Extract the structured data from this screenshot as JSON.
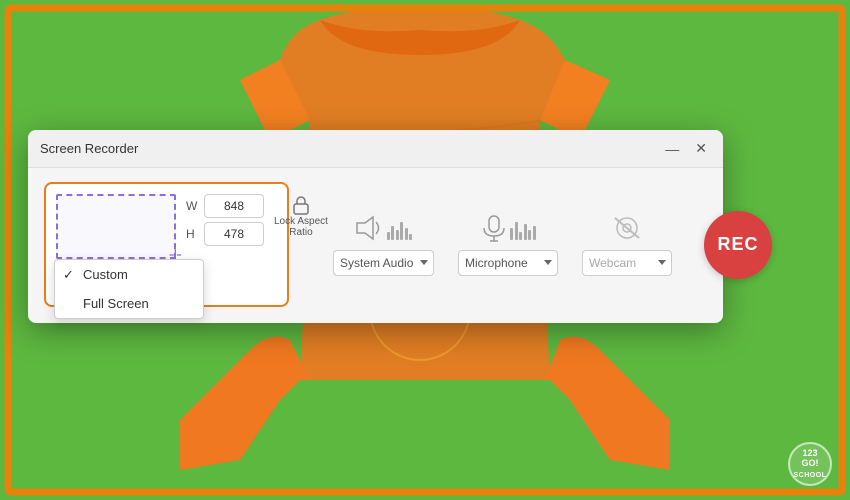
{
  "background": {
    "color": "#5aaa3c"
  },
  "dialog": {
    "title": "Screen Recorder",
    "minimize_label": "—",
    "close_label": "✕"
  },
  "region": {
    "width_label": "W",
    "height_label": "H",
    "width_value": "848",
    "height_value": "478",
    "dropdown_selected": "Custom",
    "lock_label1": "Lock Aspect",
    "lock_label2": "Ratio"
  },
  "dropdown_menu": {
    "items": [
      {
        "label": "Custom",
        "selected": true
      },
      {
        "label": "Full Screen",
        "selected": false
      }
    ]
  },
  "audio": {
    "system_label": "System Audio",
    "mic_label": "Microphone",
    "webcam_label": "Webcam"
  },
  "rec_button": {
    "label": "REC"
  },
  "logo": {
    "line1": "123",
    "line2": "GO!",
    "line3": "SCHOOL"
  }
}
